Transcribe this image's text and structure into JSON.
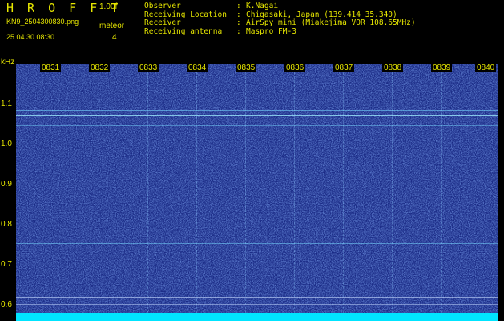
{
  "header": {
    "app_title": "H R O F F T",
    "version": "1.00f",
    "file_name": "KN9_2504300830.png",
    "mode": "meteor",
    "count": "4",
    "timestamp": "25.04.30 08:30"
  },
  "info": [
    {
      "label": "Observer",
      "value": "K.Nagai"
    },
    {
      "label": "Receiving Location",
      "value": "Chigasaki, Japan (139.414 35.340)"
    },
    {
      "label": "Receiver",
      "value": "AirSpy mini (Miakejima VOR 108.65MHz)"
    },
    {
      "label": "Receiving antenna",
      "value": "Maspro FM-3"
    }
  ],
  "separator": ":",
  "axis": {
    "y_unit": "kHz",
    "y_labels": [
      "1.1",
      "1.0",
      "0.9",
      "0.8",
      "0.7",
      "0.6"
    ],
    "time_labels": [
      "0831",
      "0832",
      "0833",
      "0834",
      "0835",
      "0836",
      "0837",
      "0838",
      "0839",
      "0840"
    ]
  },
  "colors": {
    "text": "#e6e600",
    "background": "#1a2a85",
    "signal": "#00e5ff"
  }
}
